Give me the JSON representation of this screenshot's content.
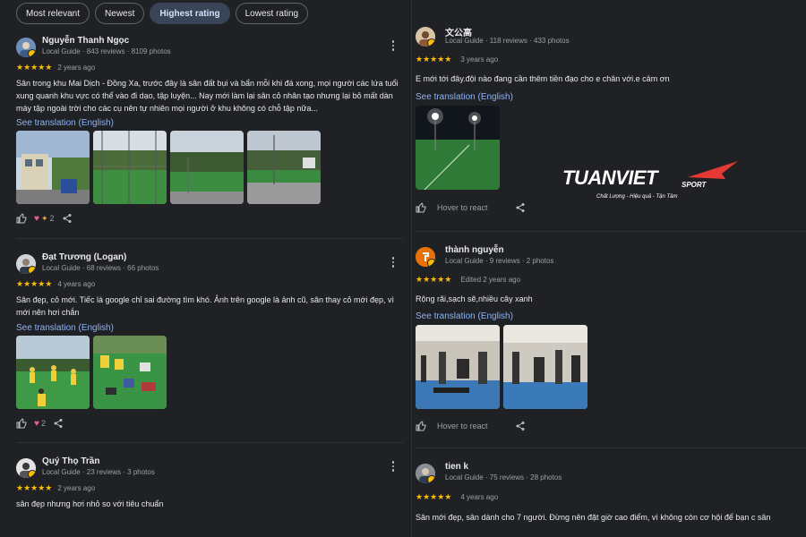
{
  "filters": [
    {
      "label": "Most relevant",
      "active": false
    },
    {
      "label": "Newest",
      "active": false
    },
    {
      "label": "Highest rating",
      "active": true
    },
    {
      "label": "Lowest rating",
      "active": false
    }
  ],
  "reviews": [
    {
      "name": "Nguyễn Thanh Ngọc",
      "meta": "Local Guide · 843 reviews · 8109 photos",
      "stars": "★★★★★",
      "when": "2 years ago",
      "text": "Sân trong khu Mai Dịch - Đồng Xa, trước đây là sân đất bụi và bẩn mỗi khi đá xong, mọi người các lứa tuổi xung quanh khu vực có thể vào đi dạo, tập luyện... Nay mới làm lại sân cỏ nhân tạo nhưng lại bỏ mất dàn máy tập ngoài trời cho các cụ nên tự nhiên mọi người ở khu không có chỗ tập nữa...",
      "translate": "See translation (English)",
      "reactions_count": "2",
      "photos": [
        "building-photo",
        "field-net-photo",
        "field-trees-photo",
        "field-cloudy-photo"
      ]
    },
    {
      "name": "Đạt Trương (Logan)",
      "meta": "Local Guide · 68 reviews · 66 photos",
      "stars": "★★★★★",
      "when": "4 years ago",
      "text": "Sân đẹp, cỏ mới. Tiếc là google chỉ sai đường tìm khó. Ảnh trên google là ảnh cũ, sân thay cỏ mới đẹp, vì mới nên hơi chắn",
      "translate": "See translation (English)",
      "reactions_count": "2",
      "photos": [
        "team-players-photo",
        "team-resting-photo"
      ]
    },
    {
      "name": "Quý Thọ Trần",
      "meta": "Local Guide · 23 reviews · 3 photos",
      "stars": "★★★★★",
      "when": "2 years ago",
      "text": "sân đẹp nhưng hơi nhỏ so với tiêu chuẩn"
    },
    {
      "name": "文公高",
      "meta": "Local Guide · 118 reviews · 433 photos",
      "stars": "★★★★★",
      "when": "3 years ago",
      "text": "E mới tới đây.đội nào đang cần thêm tiền đạo cho e chân với.e cảm ơn",
      "translate": "See translation (English)",
      "hover": "Hover to react",
      "photos": [
        "night-field-photo"
      ]
    },
    {
      "name": "thành nguyễn",
      "meta": "Local Guide · 9 reviews · 2 photos",
      "stars": "★★★★★",
      "when": "Edited 2 years ago",
      "text": "Rộng rãi,sạch sẽ,nhiều cây xanh",
      "translate": "See translation (English)",
      "hover": "Hover to react",
      "photos": [
        "gym-photo-1",
        "gym-photo-2"
      ]
    },
    {
      "name": "tien k",
      "meta": "Local Guide · 75 reviews · 28 photos",
      "stars": "★★★★★",
      "when": "4 years ago",
      "text": "Sân mới đẹp, sân dành cho 7 người. Đừng nên đặt giờ cao điểm, vì không còn cơ hội để bạn c sân"
    }
  ],
  "watermark": {
    "brand": "TUANVIET",
    "brand_suffix": "SPORT",
    "tagline": "Chất Lượng - Hiệu quả - Tận Tâm"
  },
  "colors": {
    "background": "#202124",
    "star": "#fbbc04",
    "link": "#8ab4f8",
    "active_chip": "#394457",
    "logo_accent": "#e53935"
  }
}
